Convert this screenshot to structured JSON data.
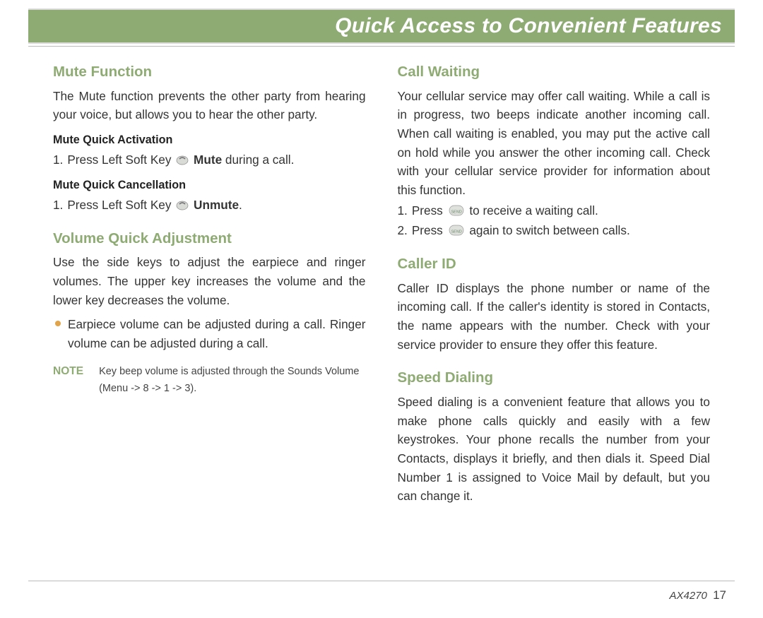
{
  "title": "Quick Access to Convenient Features",
  "left": {
    "mute": {
      "heading": "Mute Function",
      "intro": "The Mute function prevents the other party from hearing your voice, but allows you to hear the other party.",
      "activation": {
        "heading": "Mute Quick Activation",
        "num": "1.",
        "pre": "Press Left Soft Key ",
        "bold": "Mute",
        "post": " during a call."
      },
      "cancellation": {
        "heading": "Mute Quick Cancellation",
        "num": "1.",
        "pre": "Press Left Soft Key ",
        "bold": "Unmute",
        "post": "."
      }
    },
    "volume": {
      "heading": "Volume Quick Adjustment",
      "body": "Use the side keys to adjust the earpiece and ringer volumes. The upper key increases the volume and the lower key decreases the volume.",
      "bullet": "Earpiece volume can be adjusted during a call. Ringer volume can be adjusted during a call.",
      "note_label": "NOTE",
      "note_body": "Key beep volume is adjusted through the Sounds Volume (Menu -> 8 -> 1 -> 3)."
    }
  },
  "right": {
    "callwaiting": {
      "heading": "Call Waiting",
      "body": "Your cellular service may offer call waiting. While a call is in progress, two beeps indicate another incoming call. When call waiting is enabled, you may put the active call on hold while you answer the other incoming call. Check with your cellular service provider for information about this function.",
      "step1_num": "1.",
      "step1_pre": "Press ",
      "step1_post": " to receive a waiting call.",
      "step2_num": "2.",
      "step2_pre": "Press ",
      "step2_post": " again to switch between calls."
    },
    "callerid": {
      "heading": "Caller ID",
      "body": "Caller ID displays the phone number or name of the incoming call. If the caller's identity is stored in Contacts, the name appears with the number. Check with your service provider to ensure they offer this feature."
    },
    "speed": {
      "heading": "Speed Dialing",
      "body": "Speed dialing is a convenient feature that allows you to make phone calls quickly and easily with a few keystrokes. Your phone recalls the number from your Contacts, displays it briefly, and then dials it. Speed Dial Number 1 is assigned to Voice Mail by default, but you can change it."
    }
  },
  "footer": {
    "model": "AX4270",
    "page": "17"
  }
}
